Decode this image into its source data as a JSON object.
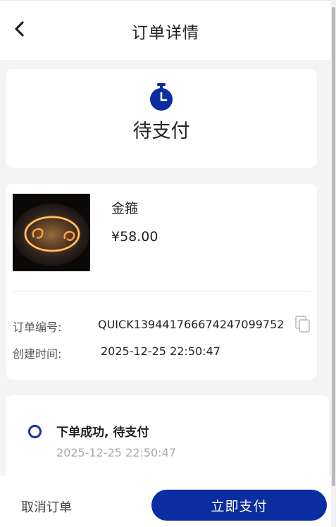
{
  "header": {
    "title": "订单详情",
    "back_icon": "chevron-left-icon"
  },
  "status": {
    "icon": "stopwatch-icon",
    "text": "待支付",
    "accent_color": "#0a2ea0"
  },
  "product": {
    "name": "金箍",
    "price": "¥58.00"
  },
  "order_info": {
    "order_no_label": "订单编号:",
    "order_no_value": "QUICK139441766674247099752",
    "created_label": "创建时间:",
    "created_value": "2025-12-25 22:50:47",
    "copy_icon": "copy-icon"
  },
  "timeline": {
    "items": [
      {
        "title": "下单成功, 待支付",
        "time": "2025-12-25 22:50:47"
      }
    ]
  },
  "actions": {
    "cancel_label": "取消订单",
    "pay_label": "立即支付"
  }
}
